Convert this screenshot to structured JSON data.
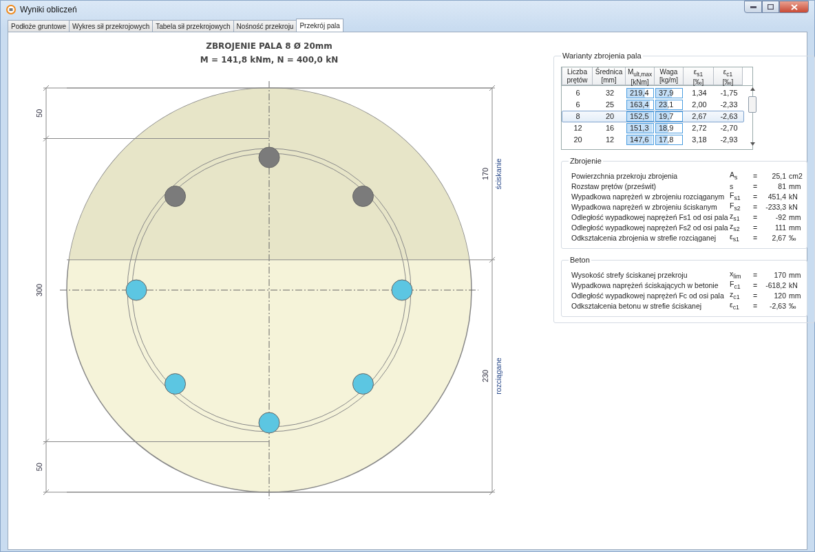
{
  "window": {
    "title": "Wyniki obliczeń"
  },
  "tabs": [
    {
      "label": "Podłoże gruntowe",
      "selected": false
    },
    {
      "label": "Wykres sił przekrojowych",
      "selected": false
    },
    {
      "label": "Tabela sił przekrojowych",
      "selected": false
    },
    {
      "label": "Nośność przekroju",
      "selected": false
    },
    {
      "label": "Przekrój pala",
      "selected": true
    }
  ],
  "drawing": {
    "title": "ZBROJENIE PALA 8 Ø 20mm",
    "subtitle": "M = 141,8 kNm,  N = 400,0 kN",
    "bars": [
      {
        "kind": "compressed"
      },
      {
        "kind": "compressed"
      },
      {
        "kind": "tensioned"
      },
      {
        "kind": "tensioned"
      },
      {
        "kind": "tensioned"
      },
      {
        "kind": "tensioned"
      },
      {
        "kind": "tensioned"
      },
      {
        "kind": "compressed"
      }
    ],
    "left_dimensions": [
      "50",
      "300",
      "50"
    ],
    "right_dimensions": [
      {
        "value": "170",
        "label": "ściskanie"
      },
      {
        "value": "230",
        "label": "rozciągane"
      }
    ]
  },
  "variants": {
    "title": "Warianty zbrojenia pala",
    "columns": [
      "Liczba prętów",
      "Średnica [mm]",
      "M$_{ult,max}$ [kNm]",
      "Waga [kg/m]",
      "ε$_{s1}$ [‰]",
      "ε$_{c1}$ [‰]"
    ],
    "rows": [
      {
        "selected": false,
        "cells": [
          {
            "text": "6"
          },
          {
            "text": "32"
          },
          {
            "text": "219,4",
            "level": 0.68
          },
          {
            "text": "37,9",
            "level": 0.6
          },
          {
            "text": "1,34"
          },
          {
            "text": "-1,75"
          }
        ]
      },
      {
        "selected": false,
        "cells": [
          {
            "text": "6"
          },
          {
            "text": "25"
          },
          {
            "text": "163,4",
            "level": 0.87
          },
          {
            "text": "23,1",
            "level": 0.45
          },
          {
            "text": "2,00"
          },
          {
            "text": "-2,33"
          }
        ]
      },
      {
        "selected": true,
        "cells": [
          {
            "text": "8"
          },
          {
            "text": "20"
          },
          {
            "text": "152,5",
            "level": 0.97
          },
          {
            "text": "19,7",
            "level": 0.55
          },
          {
            "text": "2,67"
          },
          {
            "text": "-2,63"
          }
        ]
      },
      {
        "selected": false,
        "cells": [
          {
            "text": "12"
          },
          {
            "text": "16"
          },
          {
            "text": "151,3",
            "level": 0.97
          },
          {
            "text": "18,9",
            "level": 0.45
          },
          {
            "text": "2,72"
          },
          {
            "text": "-2,70"
          }
        ]
      },
      {
        "selected": false,
        "cells": [
          {
            "text": "20"
          },
          {
            "text": "12"
          },
          {
            "text": "147,6",
            "level": 0.97
          },
          {
            "text": "17,8",
            "level": 0.45
          },
          {
            "text": "3,18"
          },
          {
            "text": "-2,93"
          }
        ]
      }
    ]
  },
  "groups": [
    {
      "title": "Zbrojenie",
      "rows": [
        {
          "label": "Powierzchnia przekroju zbrojenia",
          "symbol": "A$_{s}$",
          "equals": "=",
          "value": "25,1",
          "unit": "cm2"
        },
        {
          "label": "Rozstaw prętów (prześwit)",
          "symbol": "s",
          "equals": "=",
          "value": "81",
          "unit": "mm"
        },
        {
          "label": "Wypadkowa naprężeń w zbrojeniu rozciąganym",
          "symbol": "F$_{s1}$",
          "equals": "=",
          "value": "451,4",
          "unit": "kN"
        },
        {
          "label": "Wypadkowa naprężeń w zbrojeniu ściskanym",
          "symbol": "F$_{s2}$",
          "equals": "=",
          "value": "-233,3",
          "unit": "kN"
        },
        {
          "label": "Odległość wypadkowej naprężeń Fs1 od osi pala",
          "symbol": "z$_{s1}$",
          "equals": "=",
          "value": "-92",
          "unit": "mm"
        },
        {
          "label": "Odległość wypadkowej naprężeń Fs2 od osi pala",
          "symbol": "z$_{s2}$",
          "equals": "=",
          "value": "111",
          "unit": "mm"
        },
        {
          "label": "Odkształcenia zbrojenia w strefie rozciąganej",
          "symbol": "ε$_{s1}$",
          "equals": "=",
          "value": "2,67",
          "unit": "‰"
        }
      ]
    },
    {
      "title": "Beton",
      "rows": [
        {
          "label": "Wysokość strefy ściskanej przekroju",
          "symbol": "x$_{lim}$",
          "equals": "=",
          "value": "170",
          "unit": "mm"
        },
        {
          "label": "Wypadkowa naprężeń ściskających w betonie",
          "symbol": "F$_{c1}$",
          "equals": "=",
          "value": "-618,2",
          "unit": "kN"
        },
        {
          "label": "Odległość wypadkowej naprężeń Fc od osi pala",
          "symbol": "z$_{c1}$",
          "equals": "=",
          "value": "120",
          "unit": "mm"
        },
        {
          "label": "Odkształcenia betonu w strefie ściskanej",
          "symbol": "ε$_{c1}$",
          "equals": "=",
          "value": "-2,63",
          "unit": "‰"
        }
      ]
    }
  ]
}
